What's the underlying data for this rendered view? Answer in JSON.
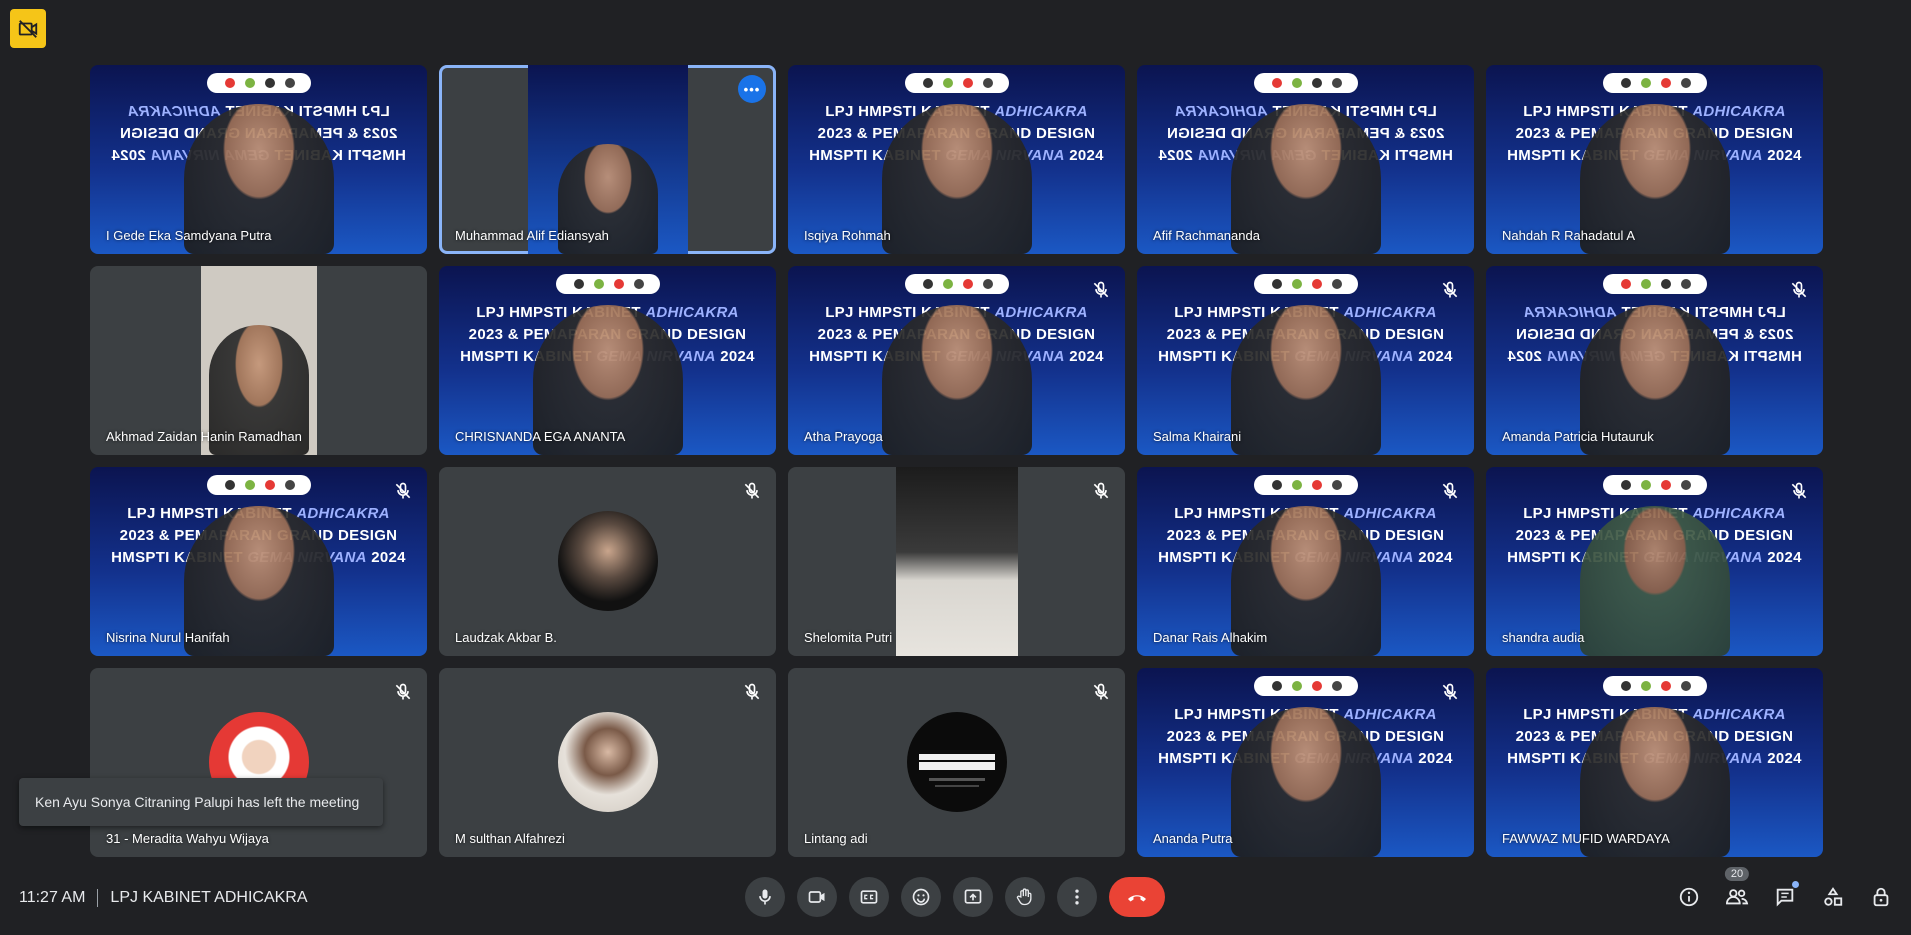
{
  "meeting": {
    "time": "11:27 AM",
    "title": "LPJ KABINET ADHICAKRA",
    "participant_count": "20"
  },
  "banner": {
    "line1": "LPJ HMPSTI KABINET",
    "line1_accent": "ADHICAKRA",
    "line2": "2023 & PEMAPARAN GRAND DESIGN",
    "line3": "HMSPTI KABINET",
    "line3_accent": "GEMA NIRVANA",
    "line3_end": "2024"
  },
  "tiles": [
    {
      "name": "I Gede Eka Samdyana Putra"
    },
    {
      "name": "Muhammad Alif Ediansyah"
    },
    {
      "name": "Isqiya Rohmah"
    },
    {
      "name": "Afif Rachmananda"
    },
    {
      "name": "Nahdah R Rahadatul A"
    },
    {
      "name": "Akhmad Zaidan Hanin Ramadhan"
    },
    {
      "name": "CHRISNANDA EGA ANANTA"
    },
    {
      "name": "Atha Prayoga"
    },
    {
      "name": "Salma Khairani"
    },
    {
      "name": "Amanda Patricia Hutauruk"
    },
    {
      "name": "Nisrina Nurul Hanifah"
    },
    {
      "name": "Laudzak Akbar B."
    },
    {
      "name": "Shelomita Putri"
    },
    {
      "name": "Danar Rais Alhakim"
    },
    {
      "name": "shandra audia"
    },
    {
      "name": "31 - Meradita Wahyu Wijaya"
    },
    {
      "name": "M sulthan Alfahrezi"
    },
    {
      "name": "Lintang adi"
    },
    {
      "name": "Ananda Putra"
    },
    {
      "name": "FAWWAZ MUFID WARDAYA"
    }
  ],
  "toast": {
    "message": "Ken Ayu Sonya Citraning Palupi has left the meeting"
  },
  "icons": {
    "recording": "recording-off-icon",
    "mic": "mic-icon",
    "camera": "camera-icon",
    "captions": "captions-icon",
    "emoji": "emoji-icon",
    "present": "present-icon",
    "raise_hand": "raise-hand-icon",
    "more": "more-options-icon",
    "hangup": "hangup-icon",
    "info": "info-icon",
    "people": "people-icon",
    "chat": "chat-icon",
    "activities": "activities-icon",
    "host_controls": "host-controls-icon"
  },
  "colors": {
    "background": "#202124",
    "tile": "#3c4043",
    "active_speaker": "#8ab4f8",
    "hangup": "#ea4335",
    "recording_badge": "#f5c518"
  }
}
